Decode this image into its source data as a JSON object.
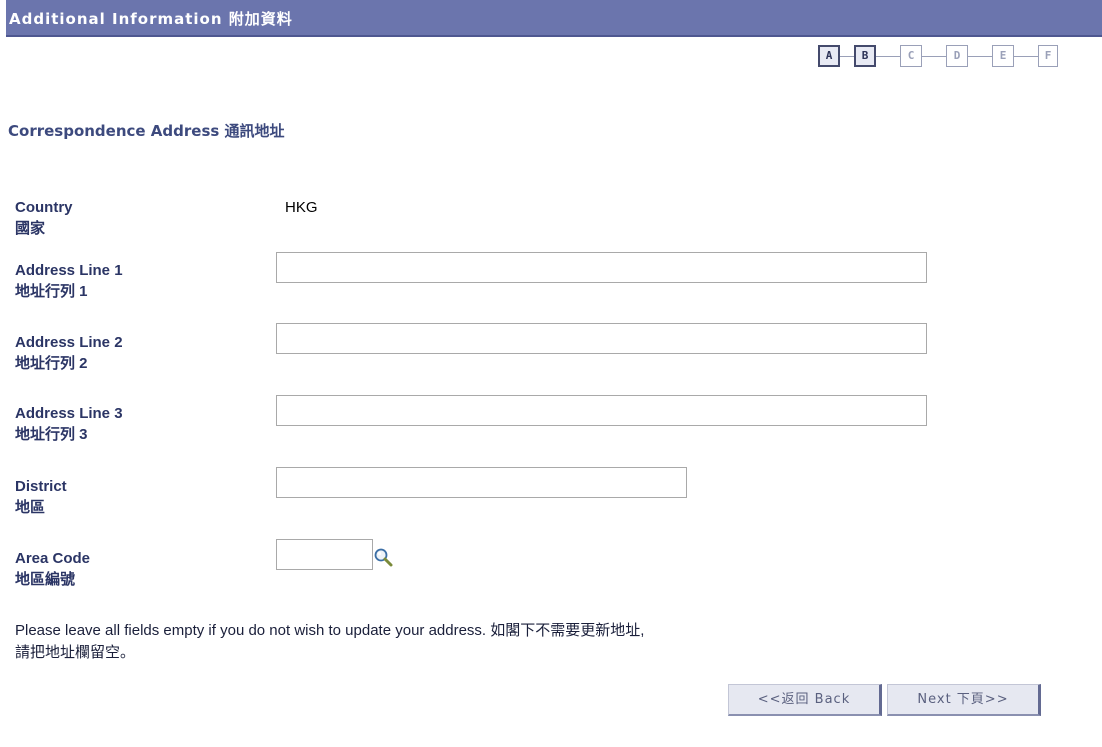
{
  "header": {
    "title": "Additional Information 附加資料"
  },
  "steps": [
    "A",
    "B",
    "C",
    "D",
    "E",
    "F"
  ],
  "steps_completed": 2,
  "section": {
    "title": "Correspondence Address 通訊地址"
  },
  "fields": {
    "country": {
      "label_en": "Country",
      "label_zh": "國家",
      "value": "HKG"
    },
    "address1": {
      "label_en": "Address Line 1",
      "label_zh": "地址行列 1",
      "value": ""
    },
    "address2": {
      "label_en": "Address Line 2",
      "label_zh": "地址行列 2",
      "value": ""
    },
    "address3": {
      "label_en": "Address Line 3",
      "label_zh": "地址行列 3",
      "value": ""
    },
    "district": {
      "label_en": "District",
      "label_zh": "地區",
      "value": ""
    },
    "area_code": {
      "label_en": "Area Code",
      "label_zh": "地區編號",
      "value": ""
    }
  },
  "note": {
    "line1": "Please leave all fields empty if you do not wish to update your address. 如閣下不需要更新地址,",
    "line2": "請把地址欄留空。"
  },
  "buttons": {
    "back": "<<返回 Back",
    "next": "Next 下頁>>"
  },
  "icons": {
    "lookup": "magnifier-icon"
  }
}
